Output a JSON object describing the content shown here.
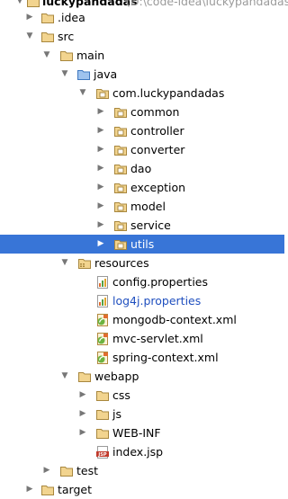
{
  "tree": {
    "root": {
      "name": "luckypandadas",
      "path": "(D:\\code-idea\\luckypandadas)"
    },
    "idea": ".idea",
    "src": "src",
    "main": "main",
    "java": "java",
    "package": "com.luckypandadas",
    "packages": [
      "common",
      "controller",
      "converter",
      "dao",
      "exception",
      "model",
      "service",
      "utils"
    ],
    "resources": "resources",
    "resource_files": [
      "config.properties",
      "log4j.properties",
      "mongodb-context.xml",
      "mvc-servlet.xml",
      "spring-context.xml"
    ],
    "webapp": "webapp",
    "webapp_items": [
      "css",
      "js",
      "WEB-INF",
      "index.jsp"
    ],
    "test": "test",
    "target": "target"
  },
  "icons": {
    "collapsed": "triangle-right-icon",
    "expanded": "triangle-down-icon",
    "folder": "folder-icon",
    "source_root": "source-root-folder-icon",
    "package": "package-icon",
    "resources_root": "resources-root-folder-icon",
    "properties": "properties-file-icon",
    "xml": "spring-xml-file-icon",
    "jsp": "jsp-file-icon"
  },
  "colors": {
    "selection": "#3875d7",
    "folder": "#e8c87a",
    "folder_outline": "#b9974a",
    "source_root": "#4d8ad6",
    "modified_file": "#1f4fbf"
  }
}
